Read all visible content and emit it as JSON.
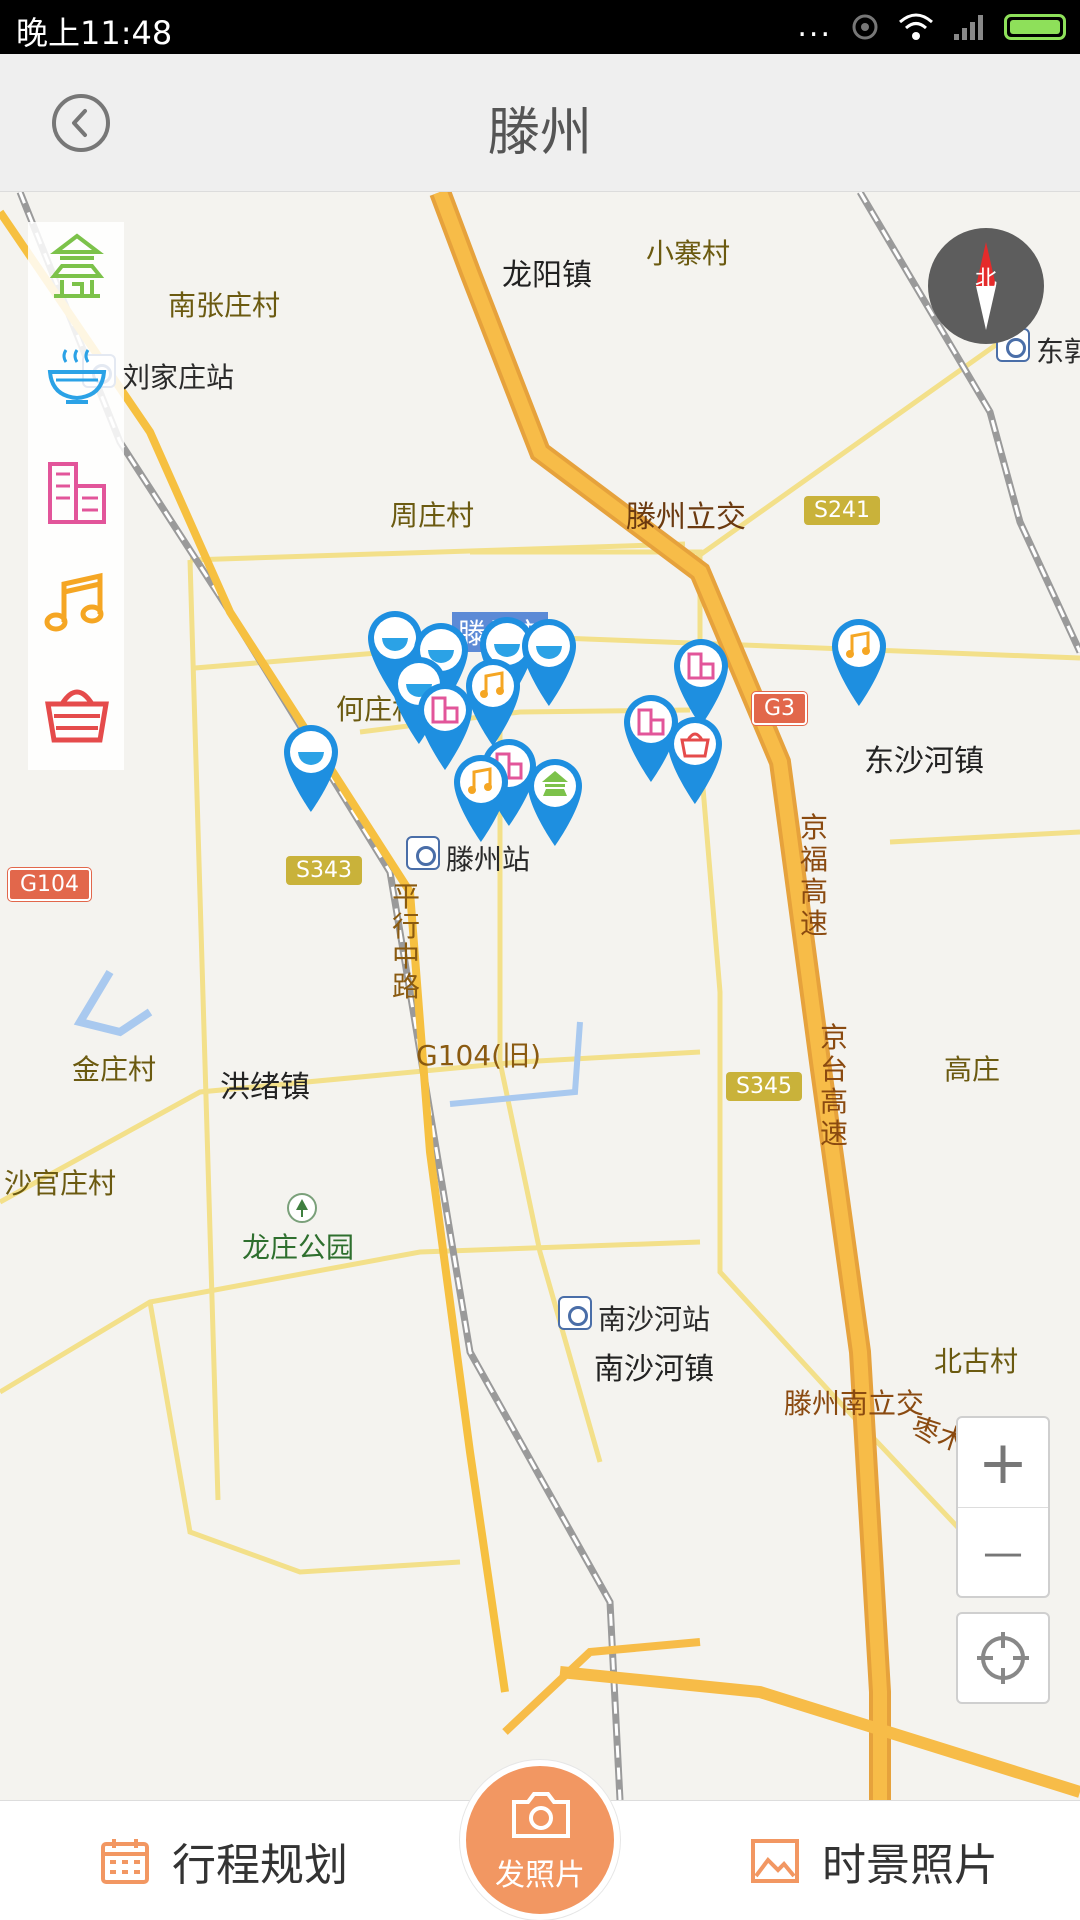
{
  "status_bar": {
    "time": "晚上11:48",
    "dots": "...",
    "battery_color": "#8ee05a"
  },
  "header": {
    "title": "滕州",
    "back_icon": "back-arrow-icon"
  },
  "categories": [
    {
      "name": "scenic-spot",
      "icon": "pagoda-icon",
      "color": "#7cc24a"
    },
    {
      "name": "food",
      "icon": "bowl-icon",
      "color": "#2ba2e6"
    },
    {
      "name": "hotel",
      "icon": "building-icon",
      "color": "#e2559a"
    },
    {
      "name": "entertainment",
      "icon": "music-note-icon",
      "color": "#f5a623"
    },
    {
      "name": "shopping",
      "icon": "basket-icon",
      "color": "#e54b4b"
    }
  ],
  "compass": {
    "label": "北"
  },
  "map": {
    "labels": {
      "longyang": "龙阳镇",
      "xiaozhai": "小寨村",
      "nanzhangzhuang": "南张庄村",
      "liujiazhuang": "刘家庄站",
      "dongguo": "东郭",
      "zhouzhuang": "周庄村",
      "tengzhou_interchange": "滕州立交",
      "hezhuang": "何庄村",
      "dongshahe": "东沙河镇",
      "tengzhou_station": "滕州站",
      "pingxing_road": "平行中路",
      "jingfu": "京福高速",
      "jintai": "京台高速",
      "jinzhuang": "金庄村",
      "hongxu": "洪绪镇",
      "gaozhuang": "高庄",
      "shaguanzhuang": "沙官庄村",
      "longzhuang_park": "龙庄公园",
      "nanshahe_station": "南沙河站",
      "nanshahe_town": "南沙河镇",
      "beiguzhuang": "北古村",
      "tengzhou_south": "滕州南立交",
      "zaomu": "枣木高速",
      "g104_old": "G104(旧)",
      "city_center": "滕州市"
    },
    "shields": {
      "s241": "S241",
      "g3": "G3",
      "g104": "G104",
      "s343": "S343",
      "s345": "S345"
    }
  },
  "zoom": {
    "plus": "+",
    "minus": "—"
  },
  "bottom_bar": {
    "itinerary_label": "行程规划",
    "camera_label": "发照片",
    "photos_label": "时景照片"
  }
}
